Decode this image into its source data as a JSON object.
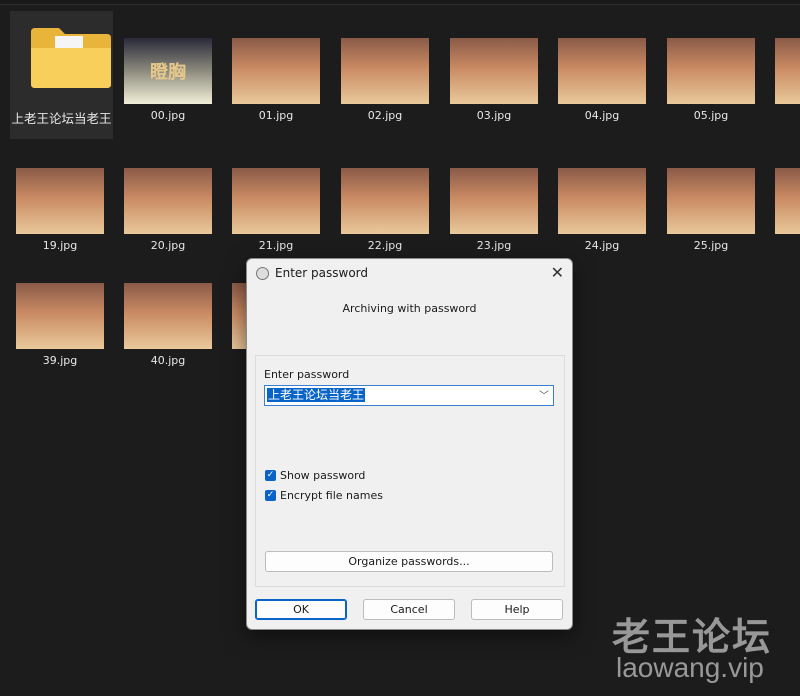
{
  "explorer": {
    "folder": {
      "name": "上老王论坛当老王",
      "icon": "folder-icon"
    },
    "files": [
      {
        "name": "00.jpg"
      },
      {
        "name": "01.jpg"
      },
      {
        "name": "02.jpg"
      },
      {
        "name": "03.jpg"
      },
      {
        "name": "04.jpg"
      },
      {
        "name": "05.jpg"
      },
      {
        "name": "19.jpg"
      },
      {
        "name": "20.jpg"
      },
      {
        "name": "21.jpg"
      },
      {
        "name": "22.jpg"
      },
      {
        "name": "23.jpg"
      },
      {
        "name": "24.jpg"
      },
      {
        "name": "25.jpg"
      },
      {
        "name": "39.jpg"
      },
      {
        "name": "40.jpg"
      }
    ],
    "title_thumb_text": "瞪胸"
  },
  "dialog": {
    "title": "Enter password",
    "subtitle": "Archiving with password",
    "password_label": "Enter password",
    "password_value": "上老王论坛当老王",
    "show_password": {
      "label": "Show password",
      "checked": true
    },
    "encrypt_names": {
      "label": "Encrypt file names",
      "checked": true
    },
    "organize_label": "Organize passwords...",
    "ok_label": "OK",
    "cancel_label": "Cancel",
    "help_label": "Help",
    "accent": "#0a64c8"
  },
  "watermark": {
    "cn": "老王论坛",
    "url": "laowang.vip"
  }
}
